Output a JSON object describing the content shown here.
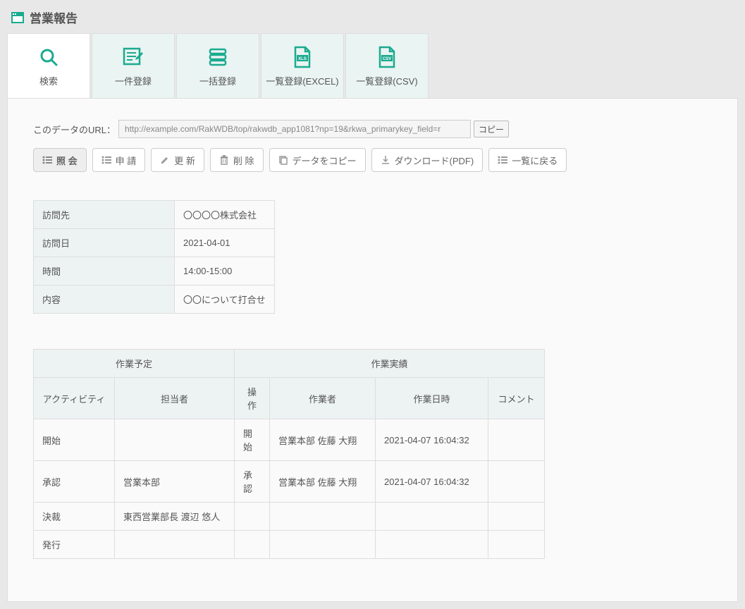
{
  "page_title": "営業報告",
  "tabs": [
    {
      "label": "検索"
    },
    {
      "label": "一件登録"
    },
    {
      "label": "一括登録"
    },
    {
      "label": "一覧登録(EXCEL)"
    },
    {
      "label": "一覧登録(CSV)"
    }
  ],
  "url_section": {
    "label": "このデータのURL：",
    "value": "http://example.com/RakWDB/top/rakwdb_app1081?np=19&rkwa_primarykey_field=r",
    "copy_btn": "コピー"
  },
  "toolbar": {
    "view": "照 会",
    "apply": "申 請",
    "update": "更 新",
    "delete": "削 除",
    "copy": "データをコピー",
    "download": "ダウンロード(PDF)",
    "back": "一覧に戻る"
  },
  "detail": {
    "rows": [
      {
        "label": "訪問先",
        "value": "〇〇〇〇株式会社"
      },
      {
        "label": "訪問日",
        "value": "2021-04-01"
      },
      {
        "label": "時間",
        "value": "14:00-15:00"
      },
      {
        "label": "内容",
        "value": "〇〇について打合せ"
      }
    ]
  },
  "workflow": {
    "group_schedule": "作業予定",
    "group_result": "作業実績",
    "col_activity": "アクティビティ",
    "col_assignee": "担当者",
    "col_op": "操作",
    "col_worker": "作業者",
    "col_datetime": "作業日時",
    "col_comment": "コメント",
    "rows": [
      {
        "activity": "開始",
        "assignee": "",
        "op": "開始",
        "worker": "営業本部 佐藤 大翔",
        "datetime": "2021-04-07 16:04:32",
        "comment": ""
      },
      {
        "activity": "承認",
        "assignee": "営業本部",
        "op": "承認",
        "worker": "営業本部 佐藤 大翔",
        "datetime": "2021-04-07 16:04:32",
        "comment": ""
      },
      {
        "activity": "決裁",
        "assignee": "東西営業部長 渡辺 悠人",
        "op": "",
        "worker": "",
        "datetime": "",
        "comment": ""
      },
      {
        "activity": "発行",
        "assignee": "",
        "op": "",
        "worker": "",
        "datetime": "",
        "comment": ""
      }
    ]
  }
}
